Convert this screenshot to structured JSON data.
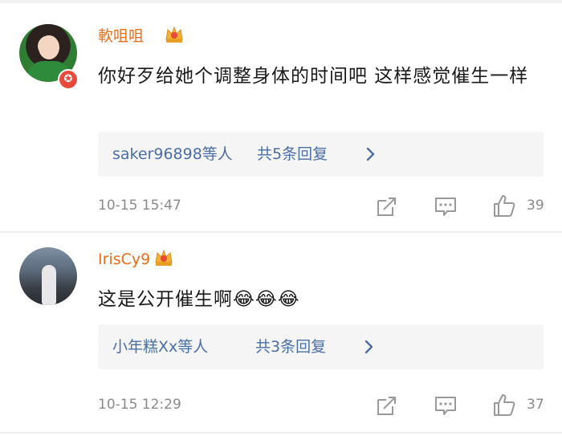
{
  "comments": [
    {
      "username": "軟咀咀",
      "text": "你好歹给她个调整身体的时间吧 这样感觉催生一样",
      "reply_users": "saker96898等人",
      "reply_count": "共5条回复",
      "timestamp": "10-15 15:47",
      "likes": "39",
      "avatar_icon": "girl-avatar",
      "verified_badge": "vip-badge-icon"
    },
    {
      "username": "IrisCy9",
      "text": "这是公开催生啊😂😂😂",
      "reply_users": "小年糕Xx等人",
      "reply_count": "共3条回复",
      "timestamp": "10-15 12:29",
      "likes": "37",
      "avatar_icon": "person-avatar"
    }
  ],
  "colors": {
    "username": "#e86c1a",
    "link": "#4a6fa5",
    "meta": "#8a8a8a"
  }
}
